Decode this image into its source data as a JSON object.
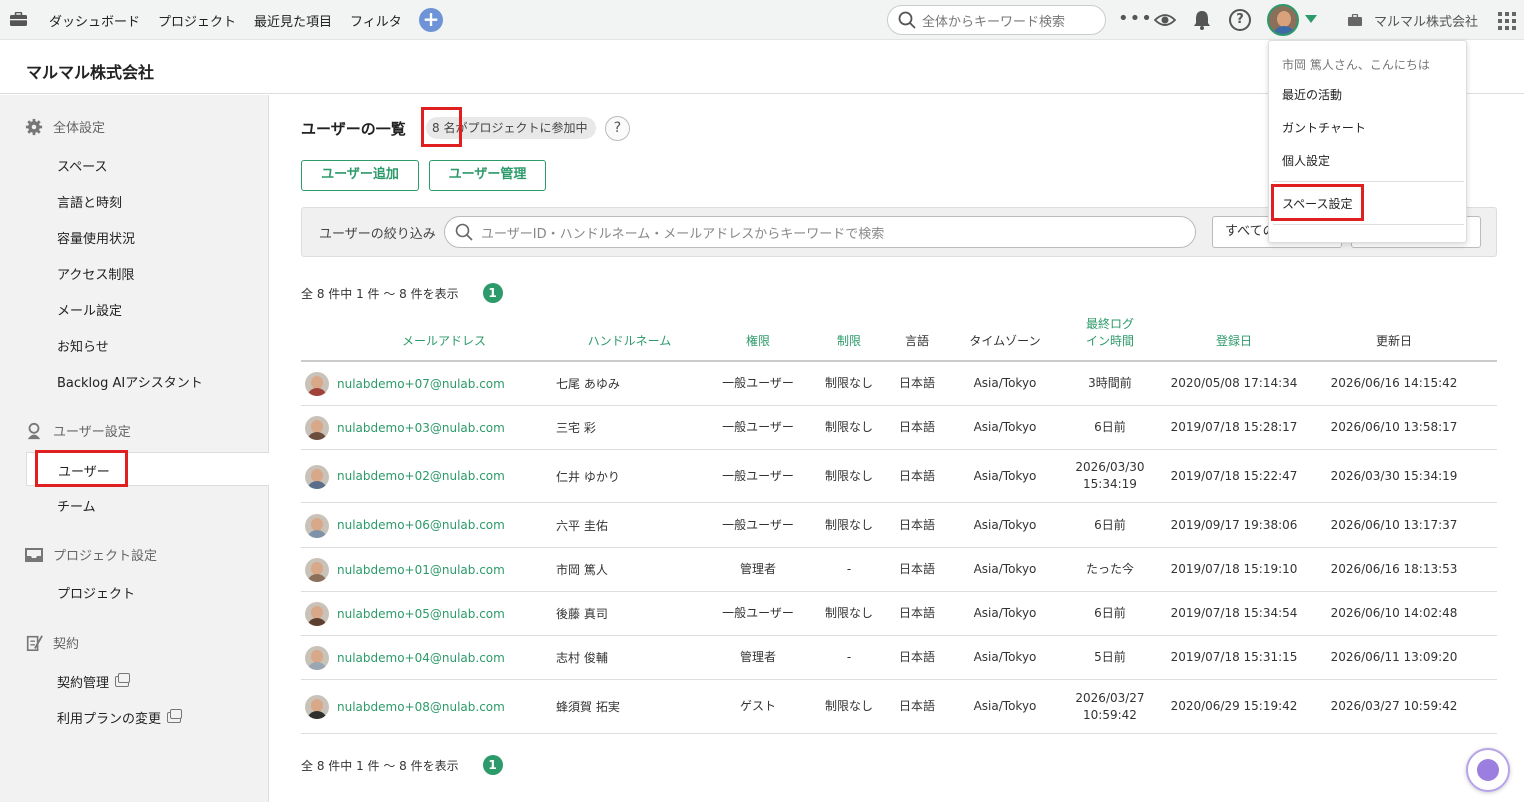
{
  "topnav": {
    "links": [
      "ダッシュボード",
      "プロジェクト",
      "最近見た項目",
      "フィルタ"
    ],
    "plus_label": "+",
    "search_placeholder": "全体からキーワード検索",
    "more_label": "•••",
    "help_label": "?",
    "space_name": "マルマル株式会社"
  },
  "header": {
    "title": "マルマル株式会社"
  },
  "sidebar": {
    "sections": [
      {
        "title": "全体設定",
        "icon": "gear-icon",
        "items": [
          "スペース",
          "言語と時刻",
          "容量使用状況",
          "アクセス制限",
          "メール設定",
          "お知らせ",
          "Backlog AIアシスタント"
        ]
      },
      {
        "title": "ユーザー設定",
        "icon": "user-icon",
        "items": [
          "ユーザー",
          "チーム"
        ]
      },
      {
        "title": "プロジェクト設定",
        "icon": "inbox-icon",
        "items": [
          "プロジェクト"
        ]
      },
      {
        "title": "契約",
        "icon": "contract-icon",
        "items": [
          "契約管理",
          "利用プランの変更"
        ]
      }
    ],
    "active": "ユーザー"
  },
  "main": {
    "title": "ユーザーの一覧",
    "count_badge": "8 名がプロジェクトに参加中",
    "help_label": "?",
    "add_user_button": "ユーザー追加",
    "manage_user_button": "ユーザー管理",
    "filter_label": "ユーザーの絞り込み",
    "filter_placeholder": "ユーザーID・ハンドルネーム・メールアドレスからキーワードで検索",
    "filter_select": "すべての",
    "paging_text": "全 8 件中 1 件 〜 8 件を表示",
    "page_number": "1"
  },
  "table": {
    "headers": [
      "メールアドレス",
      "ハンドルネーム",
      "権限",
      "制限",
      "言語",
      "タイムゾーン",
      "最終ログイン時間",
      "登録日",
      "更新日"
    ],
    "header_last_login_lines": [
      "最終ログ",
      "イン時間"
    ],
    "rows": [
      {
        "email": "nulabdemo+07@nulab.com",
        "name": "七尾 あゆみ",
        "role": "一般ユーザー",
        "limit": "制限なし",
        "lang": "日本語",
        "tz": "Asia/Tokyo",
        "last_login": [
          "3時間前"
        ],
        "registered": "2020/05/08 17:14:34",
        "updated": "2026/06/16 14:15:42",
        "avatar_color": "#a0423a"
      },
      {
        "email": "nulabdemo+03@nulab.com",
        "name": "三宅 彩",
        "role": "一般ユーザー",
        "limit": "制限なし",
        "lang": "日本語",
        "tz": "Asia/Tokyo",
        "last_login": [
          "6日前"
        ],
        "registered": "2019/07/18 15:28:17",
        "updated": "2026/06/10 13:58:17",
        "avatar_color": "#6b4e3d"
      },
      {
        "email": "nulabdemo+02@nulab.com",
        "name": "仁井 ゆかり",
        "role": "一般ユーザー",
        "limit": "制限なし",
        "lang": "日本語",
        "tz": "Asia/Tokyo",
        "last_login": [
          "2026/03/30",
          "15:34:19"
        ],
        "registered": "2019/07/18 15:22:47",
        "updated": "2026/03/30 15:34:19",
        "avatar_color": "#5a6e8c"
      },
      {
        "email": "nulabdemo+06@nulab.com",
        "name": "六平 圭佑",
        "role": "一般ユーザー",
        "limit": "制限なし",
        "lang": "日本語",
        "tz": "Asia/Tokyo",
        "last_login": [
          "6日前"
        ],
        "registered": "2019/09/17 19:38:06",
        "updated": "2026/06/10 13:17:37",
        "avatar_color": "#7e93a8"
      },
      {
        "email": "nulabdemo+01@nulab.com",
        "name": "市岡 篤人",
        "role": "管理者",
        "limit": "-",
        "lang": "日本語",
        "tz": "Asia/Tokyo",
        "last_login": [
          "たった今"
        ],
        "registered": "2019/07/18 15:19:10",
        "updated": "2026/06/16 18:13:53",
        "avatar_color": "#8a6f5a"
      },
      {
        "email": "nulabdemo+05@nulab.com",
        "name": "後藤 真司",
        "role": "一般ユーザー",
        "limit": "制限なし",
        "lang": "日本語",
        "tz": "Asia/Tokyo",
        "last_login": [
          "6日前"
        ],
        "registered": "2019/07/18 15:34:54",
        "updated": "2026/06/10 14:02:48",
        "avatar_color": "#5c3f2e"
      },
      {
        "email": "nulabdemo+04@nulab.com",
        "name": "志村 俊輔",
        "role": "管理者",
        "limit": "-",
        "lang": "日本語",
        "tz": "Asia/Tokyo",
        "last_login": [
          "5日前"
        ],
        "registered": "2019/07/18 15:31:15",
        "updated": "2026/06/11 13:09:20",
        "avatar_color": "#9aa6b2"
      },
      {
        "email": "nulabdemo+08@nulab.com",
        "name": "蜂須賀 拓実",
        "role": "ゲスト",
        "limit": "制限なし",
        "lang": "日本語",
        "tz": "Asia/Tokyo",
        "last_login": [
          "2026/03/27",
          "10:59:42"
        ],
        "registered": "2020/06/29 15:19:42",
        "updated": "2026/03/27 10:59:42",
        "avatar_color": "#2f2f2f"
      }
    ]
  },
  "dropdown": {
    "greeting": "市岡 篤人さん、こんにちは",
    "items": [
      "最近の活動",
      "ガントチャート",
      "個人設定"
    ],
    "space_settings": "スペース設定"
  },
  "colors": {
    "accent": "#2c9a6a",
    "highlight": "#e02020",
    "plus": "#6e93d6"
  }
}
